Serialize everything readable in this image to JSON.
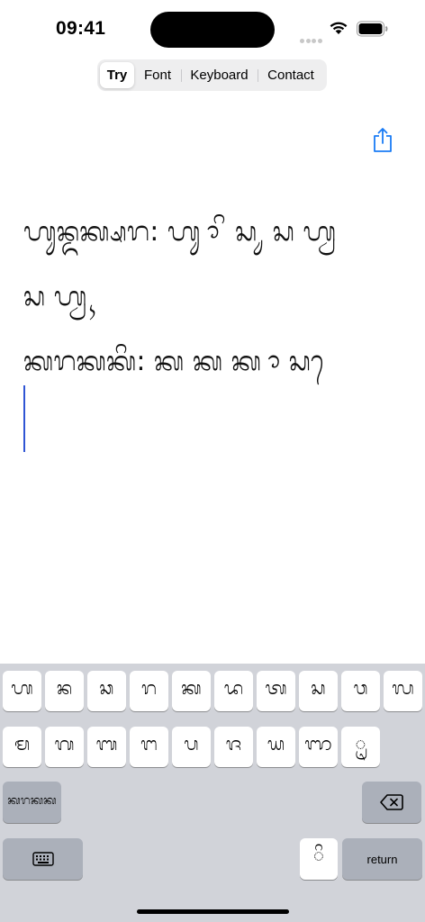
{
  "status_bar": {
    "time": "09:41"
  },
  "tabs": [
    {
      "label": "Try",
      "active": true
    },
    {
      "label": "Font",
      "active": false
    },
    {
      "label": "Keyboard",
      "active": false
    },
    {
      "label": "Contact",
      "active": false
    }
  ],
  "share": {
    "icon": "share-icon",
    "color": "#1a7cf5"
  },
  "editor": {
    "lines": [
      "ᬳᬸᬦ᭄ᬤᬓ᭄ᬱᬭ: ᬳᬸ ᬵ ᬶ ᬲ ᬸ ᬲ ᬳ᭄ᬯ",
      "ᬲ ᬳ᭄ᬯ ᬹ",
      "ᬓᬭᬓᬓᬶ: ᬓ ᬓ ᬓ ᬵ ᬲ ᬾ"
    ],
    "cursor_color": "#2f55d4"
  },
  "keyboard": {
    "row1": [
      "ᬳ",
      "ᬦ",
      "ᬘ",
      "ᬭ",
      "ᬓ",
      "ᬤ",
      "ᬢ",
      "ᬲ",
      "ᬯ",
      "ᬮ"
    ],
    "row2": [
      "ᬫ",
      "ᬕ",
      "ᬩ",
      "ᬗ",
      "ᬧ",
      "ᬚ",
      "ᬬ",
      "ᬜ",
      "ᬺ"
    ],
    "switch_label": "ᬓᬭᬓᬓ",
    "delete_icon": "backspace-icon",
    "keyboard_icon": "keyboard-icon",
    "accent_key": "ᬶ",
    "return_label": "return"
  }
}
